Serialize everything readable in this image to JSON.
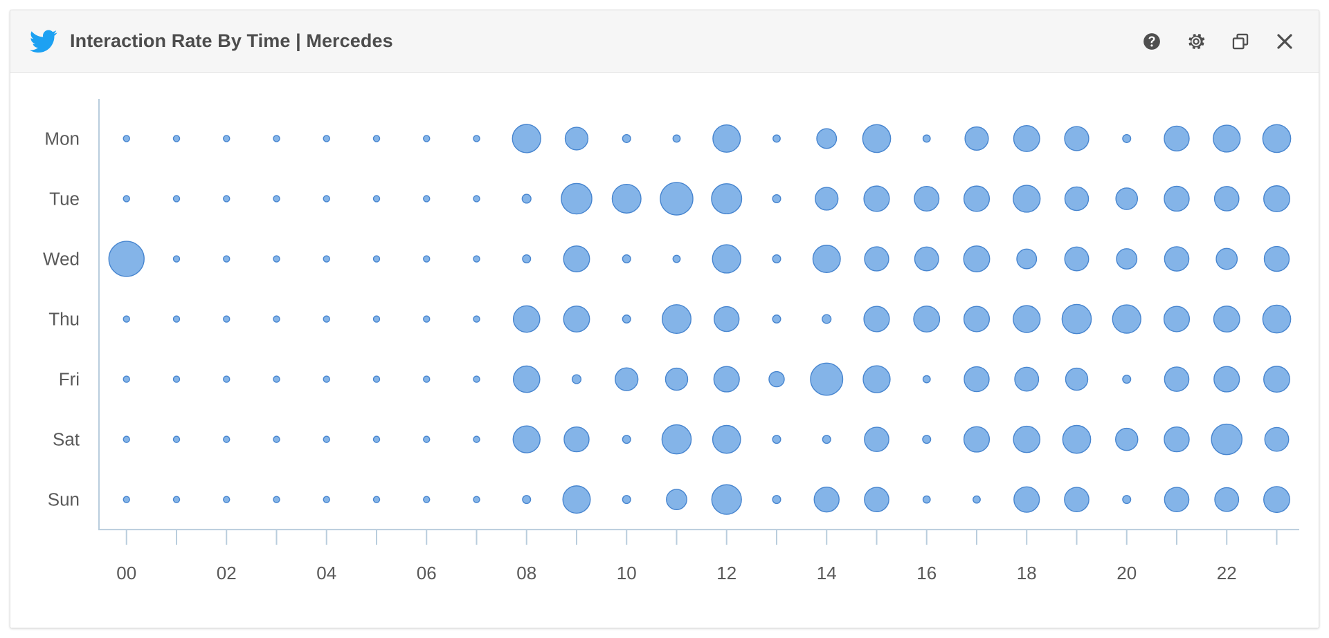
{
  "window": {
    "title": "Interaction Rate By Time | Mercedes",
    "brand_icon": "twitter-bird-icon",
    "brand_color": "#1da1f2",
    "actions": [
      {
        "name": "help-button",
        "icon": "question-circle-icon",
        "label": "Help"
      },
      {
        "name": "settings-button",
        "icon": "gear-icon",
        "label": "Settings"
      },
      {
        "name": "duplicate-button",
        "icon": "copy-icon",
        "label": "Duplicate"
      },
      {
        "name": "close-button",
        "icon": "close-icon",
        "label": "Close"
      }
    ]
  },
  "style": {
    "bubble_fill": "#84b4e8",
    "bubble_stroke": "#4785cf",
    "axis_color": "#b9cddd",
    "header_bg": "#f6f6f6",
    "text_color": "#595959"
  },
  "chart_data": {
    "type": "scatter",
    "title": "Interaction Rate By Time | Mercedes",
    "subtitle": "",
    "xlabel": "",
    "ylabel": "",
    "size_encoding": "Interaction rate (bubble area)",
    "grid": false,
    "legend": "none",
    "x": [
      0,
      1,
      2,
      3,
      4,
      5,
      6,
      7,
      8,
      9,
      10,
      11,
      12,
      13,
      14,
      15,
      16,
      17,
      18,
      19,
      20,
      21,
      22,
      23
    ],
    "x_tick_labels": [
      "00",
      "",
      "02",
      "",
      "04",
      "",
      "06",
      "",
      "08",
      "",
      "10",
      "",
      "12",
      "",
      "14",
      "",
      "16",
      "",
      "18",
      "",
      "20",
      "",
      "22",
      ""
    ],
    "x_tick_label_interval": 2,
    "categories": [
      "Mon",
      "Tue",
      "Wed",
      "Thu",
      "Fri",
      "Sat",
      "Sun"
    ],
    "value_range": [
      0.02,
      1.0
    ],
    "series": [
      {
        "name": "Mon",
        "values": [
          0.03,
          0.03,
          0.03,
          0.03,
          0.03,
          0.03,
          0.03,
          0.03,
          0.62,
          0.4,
          0.05,
          0.04,
          0.58,
          0.04,
          0.3,
          0.6,
          0.04,
          0.42,
          0.52,
          0.45,
          0.05,
          0.48,
          0.56,
          0.6
        ]
      },
      {
        "name": "Tue",
        "values": [
          0.03,
          0.03,
          0.03,
          0.03,
          0.03,
          0.03,
          0.03,
          0.03,
          0.06,
          0.72,
          0.64,
          0.82,
          0.7,
          0.05,
          0.4,
          0.5,
          0.47,
          0.5,
          0.56,
          0.43,
          0.36,
          0.48,
          0.46,
          0.52
        ]
      },
      {
        "name": "Wed",
        "values": [
          0.96,
          0.03,
          0.03,
          0.03,
          0.03,
          0.03,
          0.03,
          0.03,
          0.05,
          0.52,
          0.05,
          0.04,
          0.62,
          0.05,
          0.58,
          0.45,
          0.44,
          0.52,
          0.3,
          0.44,
          0.32,
          0.46,
          0.34,
          0.48
        ]
      },
      {
        "name": "Thu",
        "values": [
          0.03,
          0.03,
          0.03,
          0.03,
          0.03,
          0.03,
          0.03,
          0.03,
          0.54,
          0.52,
          0.05,
          0.64,
          0.48,
          0.05,
          0.06,
          0.5,
          0.52,
          0.5,
          0.56,
          0.66,
          0.62,
          0.5,
          0.52,
          0.6
        ]
      },
      {
        "name": "Fri",
        "values": [
          0.03,
          0.03,
          0.03,
          0.03,
          0.03,
          0.03,
          0.03,
          0.03,
          0.54,
          0.06,
          0.4,
          0.38,
          0.5,
          0.18,
          0.8,
          0.56,
          0.04,
          0.48,
          0.44,
          0.38,
          0.05,
          0.46,
          0.5,
          0.52
        ]
      },
      {
        "name": "Sat",
        "values": [
          0.03,
          0.03,
          0.03,
          0.03,
          0.03,
          0.03,
          0.03,
          0.03,
          0.56,
          0.48,
          0.05,
          0.66,
          0.6,
          0.05,
          0.05,
          0.46,
          0.05,
          0.5,
          0.54,
          0.6,
          0.38,
          0.48,
          0.72,
          0.44
        ]
      },
      {
        "name": "Sun",
        "values": [
          0.03,
          0.03,
          0.03,
          0.03,
          0.03,
          0.03,
          0.03,
          0.03,
          0.05,
          0.58,
          0.05,
          0.32,
          0.68,
          0.05,
          0.48,
          0.46,
          0.04,
          0.04,
          0.5,
          0.46,
          0.05,
          0.46,
          0.44,
          0.52
        ]
      }
    ]
  }
}
